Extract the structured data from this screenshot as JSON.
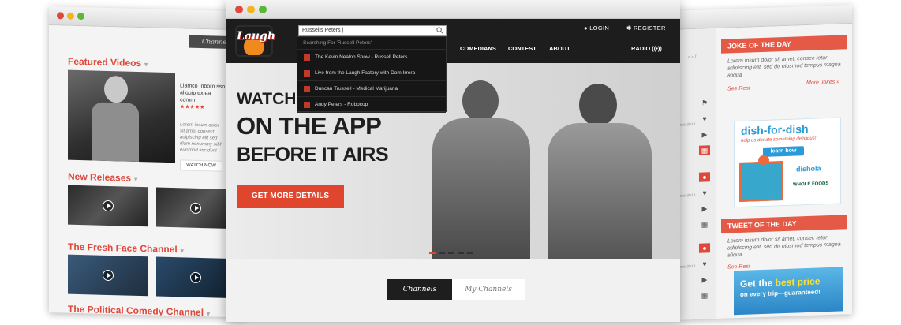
{
  "left_window": {
    "channels_tab": "Channels",
    "featured": {
      "title": "Featured Videos",
      "desc_line1": "Llamco Inborn ssn",
      "desc_line2": "aliquip ex ea comm",
      "stars": "★★★★★",
      "desc_lines": [
        "Lorem ipsum dolor",
        "sit amet consect",
        "adipiscing elit sed",
        "diam nonummy nibh",
        "euismod tincidunt"
      ],
      "watch_label": "WATCH NOW"
    },
    "new_releases": {
      "title": "New Releases"
    },
    "fresh_face": {
      "title": "The Fresh Face Channel"
    },
    "political": {
      "title": "The Political Comedy Channel"
    }
  },
  "main_window": {
    "logo_text": "Laugh",
    "search": {
      "value": "Russells Peters |"
    },
    "header_nav": {
      "login": "LOGIN",
      "register": "REGISTER"
    },
    "sub_nav": {
      "comedians": "COMEDIANS",
      "contest": "CONTEST",
      "about": "ABOUT",
      "radio": "RADIO"
    },
    "dropdown": {
      "heading": "Searching For 'Russell Peters'",
      "items": [
        "The Kevin Nealon Show - Russell Peters",
        "Live from the Laugh Factory with Dom Irrera",
        "Duncan Trussell - Medical Marijuana",
        "Andy Peters - Robocop"
      ]
    },
    "hero": {
      "line1": "WATCH",
      "line2": "ON THE APP",
      "line3": "BEFORE IT AIRS",
      "cta": "GET MORE DETAILS",
      "active_slide": 1,
      "slide_count": 5
    },
    "tabs": {
      "channels": "Channels",
      "my_channels": "My Channels"
    }
  },
  "right_window": {
    "joke": {
      "title": "JOKE OF THE DAY",
      "text": "Lorem ipsum dolor sit amet, consec tetur adipiscing elit, sed do eiusmod tempus magna aliqua",
      "see_rest": "See Rest",
      "more": "More Jokes »"
    },
    "dish_ad": {
      "title": "dish-for-dish",
      "sub": "help us donate something delicious!",
      "learn": "learn how",
      "brand": "dishola",
      "partner": "WHOLE FOODS"
    },
    "tweet": {
      "title": "TWEET OF THE DAY",
      "text": "Lorem ipsum dolor sit amet, consec tetur adipiscing elit, sed do eiusmod tempus magna aliqua",
      "see_rest": "See Rest"
    },
    "price_ad": {
      "line1_a": "Get the ",
      "line1_b": "best price",
      "line2": "on every trip—guaranteed!"
    },
    "dates": [
      "June 2014",
      "June 2014",
      "June 2014",
      "June 2014"
    ]
  },
  "colors": {
    "accent": "#e0452e",
    "dark": "#1d1d1d",
    "blue": "#2b9ad8"
  }
}
